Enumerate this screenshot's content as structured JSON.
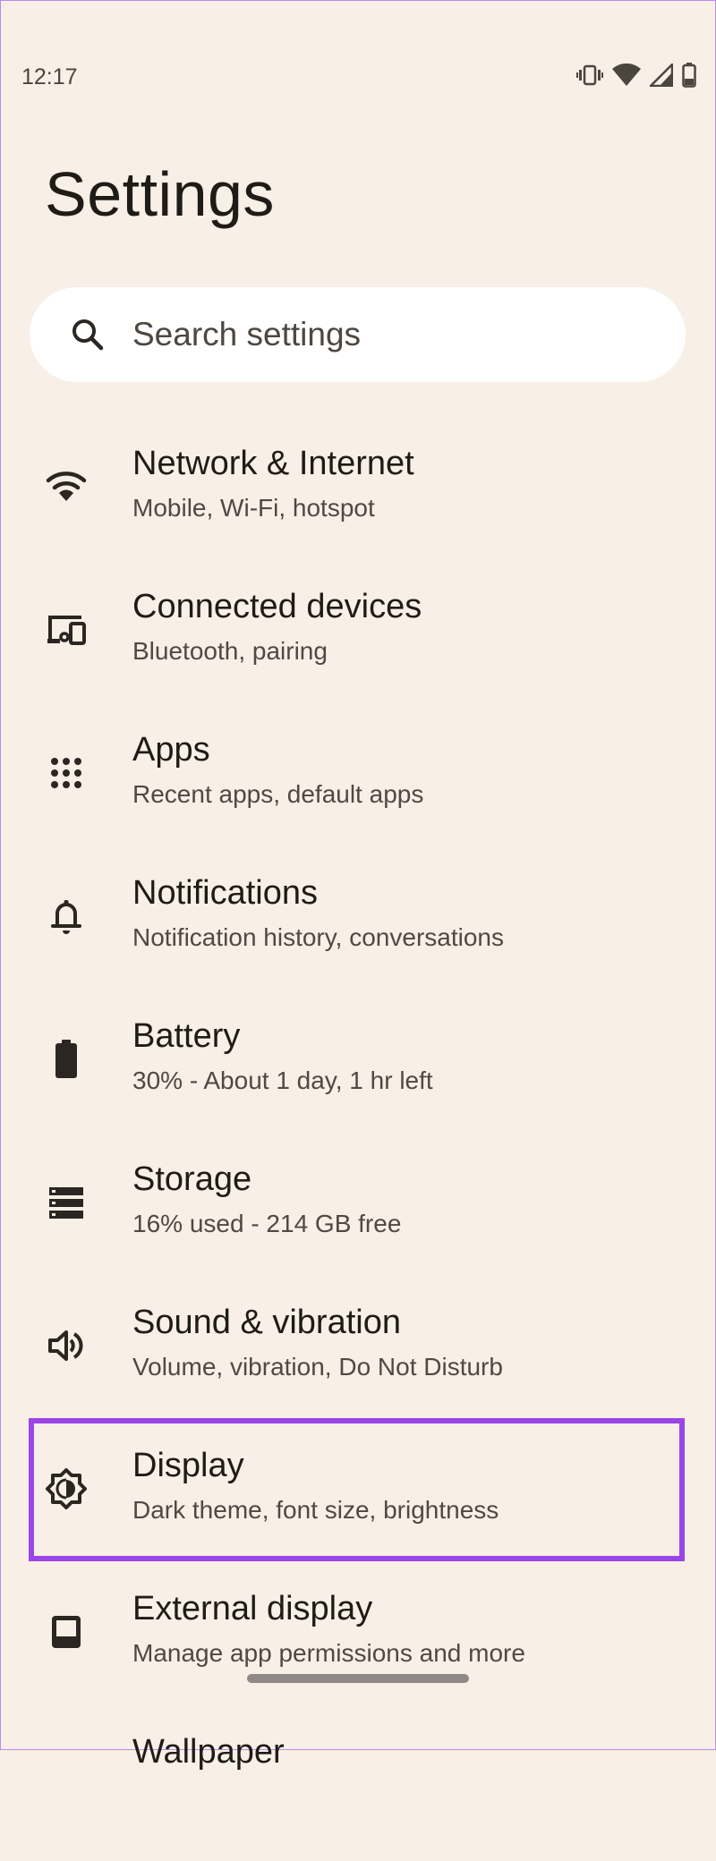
{
  "status_bar": {
    "time": "12:17",
    "icons": [
      "vibrate-icon",
      "wifi-icon",
      "cell-signal-icon",
      "battery-icon"
    ]
  },
  "page": {
    "title": "Settings"
  },
  "search": {
    "placeholder": "Search settings"
  },
  "settings": [
    {
      "icon": "wifi-icon",
      "title": "Network & Internet",
      "subtitle": "Mobile, Wi-Fi, hotspot"
    },
    {
      "icon": "connected-devices-icon",
      "title": "Connected devices",
      "subtitle": "Bluetooth, pairing"
    },
    {
      "icon": "apps-grid-icon",
      "title": "Apps",
      "subtitle": "Recent apps, default apps"
    },
    {
      "icon": "bell-icon",
      "title": "Notifications",
      "subtitle": "Notification history, conversations"
    },
    {
      "icon": "battery-icon",
      "title": "Battery",
      "subtitle": "30% - About 1 day, 1 hr left"
    },
    {
      "icon": "storage-icon",
      "title": "Storage",
      "subtitle": "16% used - 214 GB free"
    },
    {
      "icon": "volume-icon",
      "title": "Sound & vibration",
      "subtitle": "Volume, vibration, Do Not Disturb"
    },
    {
      "icon": "brightness-icon",
      "title": "Display",
      "subtitle": "Dark theme, font size, brightness"
    },
    {
      "icon": "external-display-icon",
      "title": "External display",
      "subtitle": "Manage app permissions and more"
    },
    {
      "icon": "wallpaper-icon",
      "title": "Wallpaper",
      "subtitle": ""
    }
  ],
  "highlighted_item": "Display",
  "colors": {
    "background": "#f8efe6",
    "search_background": "#ffffff",
    "highlight_border": "#9b45e8",
    "text_primary": "#1f1b16",
    "text_secondary": "#4f4943"
  }
}
